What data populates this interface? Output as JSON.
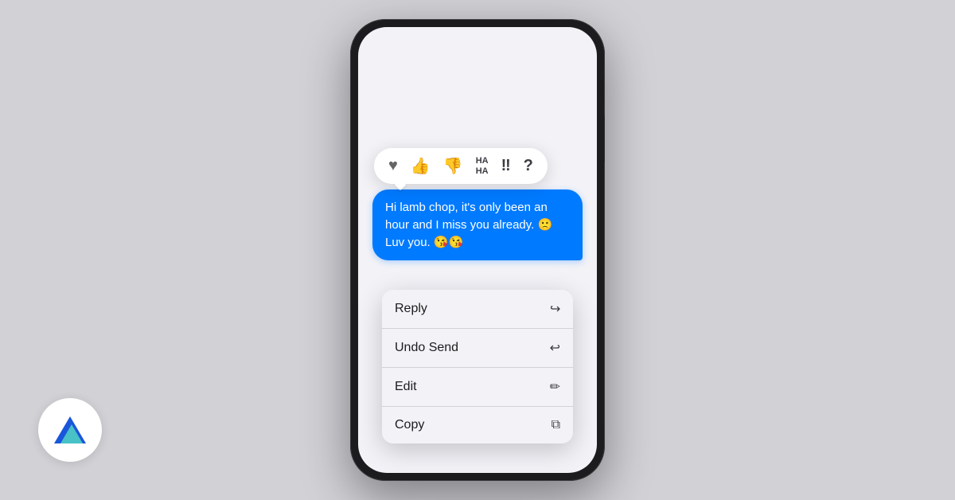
{
  "background": {
    "color": "#d1d1d6"
  },
  "phone": {
    "frame_color": "#1c1c1e",
    "screen_bg": "#f2f2f7"
  },
  "reactions": {
    "items": [
      {
        "id": "heart",
        "symbol": "♥",
        "label": "Love"
      },
      {
        "id": "thumbs-up",
        "symbol": "👍",
        "label": "Like"
      },
      {
        "id": "thumbs-down",
        "symbol": "👎",
        "label": "Dislike"
      },
      {
        "id": "haha",
        "symbol": "HA\nHA",
        "label": "Haha"
      },
      {
        "id": "exclamation",
        "symbol": "‼",
        "label": "Emphasize"
      },
      {
        "id": "question",
        "symbol": "?",
        "label": "Question"
      }
    ]
  },
  "message": {
    "text": "Hi lamb chop, it's only been an hour and I miss you already. 🙁 Luv you. 😘😘"
  },
  "context_menu": {
    "items": [
      {
        "id": "reply",
        "label": "Reply",
        "icon": "↩"
      },
      {
        "id": "undo-send",
        "label": "Undo Send",
        "icon": "↩"
      },
      {
        "id": "edit",
        "label": "Edit",
        "icon": "✏"
      },
      {
        "id": "copy",
        "label": "Copy",
        "icon": "⧉"
      }
    ]
  },
  "logo": {
    "alt": "App logo"
  }
}
